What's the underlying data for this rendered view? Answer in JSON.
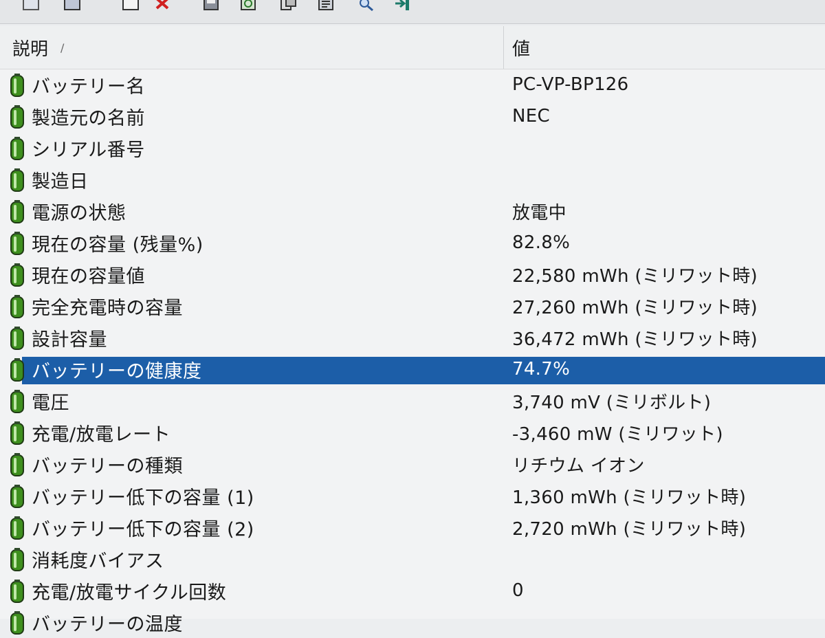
{
  "toolbar": {
    "buttons": [
      "view-icon",
      "view-icon-2",
      "window-icon",
      "delete-icon",
      "save-icon",
      "refresh-icon",
      "copy-icon",
      "properties-icon",
      "search-icon",
      "exit-icon"
    ]
  },
  "columns": {
    "description": "説明",
    "value": "値"
  },
  "rows": [
    {
      "label": "バッテリー名",
      "value": "PC-VP-BP126"
    },
    {
      "label": "製造元の名前",
      "value": "NEC"
    },
    {
      "label": "シリアル番号",
      "value": ""
    },
    {
      "label": "製造日",
      "value": ""
    },
    {
      "label": "電源の状態",
      "value": "放電中"
    },
    {
      "label": "現在の容量 (残量%)",
      "value": "82.8%"
    },
    {
      "label": "現在の容量値",
      "value": "22,580 mWh (ミリワット時)"
    },
    {
      "label": "完全充電時の容量",
      "value": "27,260 mWh (ミリワット時)"
    },
    {
      "label": "設計容量",
      "value": "36,472 mWh (ミリワット時)"
    },
    {
      "label": "バッテリーの健康度",
      "value": "74.7%"
    },
    {
      "label": "電圧",
      "value": "3,740 mV (ミリボルト)"
    },
    {
      "label": "充電/放電レート",
      "value": "-3,460 mW (ミリワット)"
    },
    {
      "label": "バッテリーの種類",
      "value": "リチウム イオン"
    },
    {
      "label": "バッテリー低下の容量 (1)",
      "value": "1,360 mWh (ミリワット時)"
    },
    {
      "label": "バッテリー低下の容量 (2)",
      "value": "2,720 mWh (ミリワット時)"
    },
    {
      "label": "消耗度バイアス",
      "value": ""
    },
    {
      "label": "充電/放電サイクル回数",
      "value": "0"
    },
    {
      "label": "バッテリーの温度",
      "value": ""
    }
  ],
  "selected_row": 9,
  "colors": {
    "selection": "#1c5ea8",
    "battery_icon": "#3e8f1e"
  }
}
